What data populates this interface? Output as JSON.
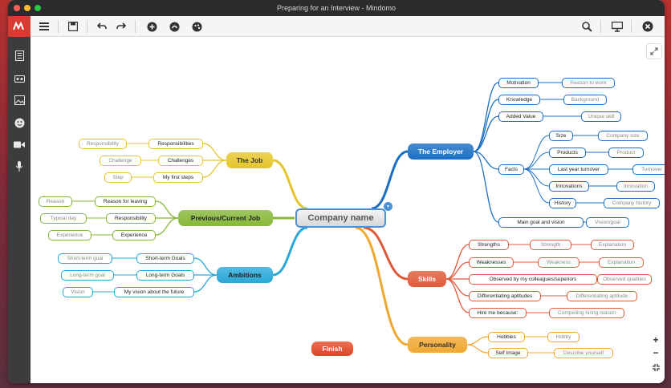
{
  "window": {
    "title": "Preparing for an Interview - Mindomo"
  },
  "colors": {
    "employer": "#1a6fc4",
    "skills": "#e05a3a",
    "personality": "#f0a830",
    "job": "#e6c52a",
    "previous": "#86b838",
    "ambitions": "#29a8d8",
    "finish": "#e0533a",
    "center_border": "#4a90d9"
  },
  "toolbar": {
    "icons": [
      "menu-icon",
      "save-icon",
      "undo-icon",
      "redo-icon",
      "add-topic-icon",
      "link-icon",
      "palette-icon",
      "search-icon",
      "present-icon",
      "close-icon"
    ]
  },
  "sidebar": {
    "icons": [
      "outline-icon",
      "format-icon",
      "image-icon",
      "emoji-icon",
      "video-icon",
      "microphone-icon"
    ]
  },
  "map": {
    "center": "Company name",
    "finish": "Finish",
    "employer": {
      "label": "The Employer",
      "items": [
        {
          "label": "Motivation",
          "child": "Reason to work"
        },
        {
          "label": "Knowledge",
          "child": "Background"
        },
        {
          "label": "Added Value",
          "child": "Unique skill"
        },
        {
          "label": "Facts",
          "subs": [
            {
              "label": "Size",
              "child": "Company size"
            },
            {
              "label": "Products",
              "child": "Product"
            },
            {
              "label": "Last year turnover",
              "child": "Turnover"
            },
            {
              "label": "Innovations",
              "child": "Innovation"
            },
            {
              "label": "History",
              "child": "Company history"
            }
          ]
        },
        {
          "label": "Main goal and vision",
          "child": "Vision/goal"
        }
      ]
    },
    "skills": {
      "label": "Skills",
      "items": [
        {
          "label": "Strengths",
          "child": "Strength",
          "grand": "Explanation"
        },
        {
          "label": "Weaknesses",
          "child": "Weakness",
          "grand": "Explanation"
        },
        {
          "label": "Observed by my colleagues/superiors",
          "child": "Observed qualities"
        },
        {
          "label": "Differentiating aptitudes",
          "child": "Differentiating aptitude"
        },
        {
          "label": "Hire me because:",
          "child": "Compelling hiring reason"
        }
      ]
    },
    "personality": {
      "label": "Personality",
      "items": [
        {
          "label": "Hobbies",
          "child": "Hobby"
        },
        {
          "label": "Self Image",
          "child": "Describe yourself"
        }
      ]
    },
    "job": {
      "label": "The Job",
      "items": [
        {
          "label": "Responsibilities",
          "child": "Responsibility"
        },
        {
          "label": "Challenges",
          "child": "Challenge"
        },
        {
          "label": "My first steps",
          "child": "Step"
        }
      ]
    },
    "previous": {
      "label": "Previous/Current Job",
      "items": [
        {
          "label": "Reason for leaving",
          "child": "Reason"
        },
        {
          "label": "Responsibility",
          "child": "Typical day"
        },
        {
          "label": "Experience",
          "child": "Experience"
        }
      ]
    },
    "ambitions": {
      "label": "Ambitions",
      "items": [
        {
          "label": "Short-term Goals",
          "child": "Short-term goal"
        },
        {
          "label": "Long-term Goals",
          "child": "Long-term goal"
        },
        {
          "label": "My vision about the future",
          "child": "Vision"
        }
      ]
    }
  }
}
